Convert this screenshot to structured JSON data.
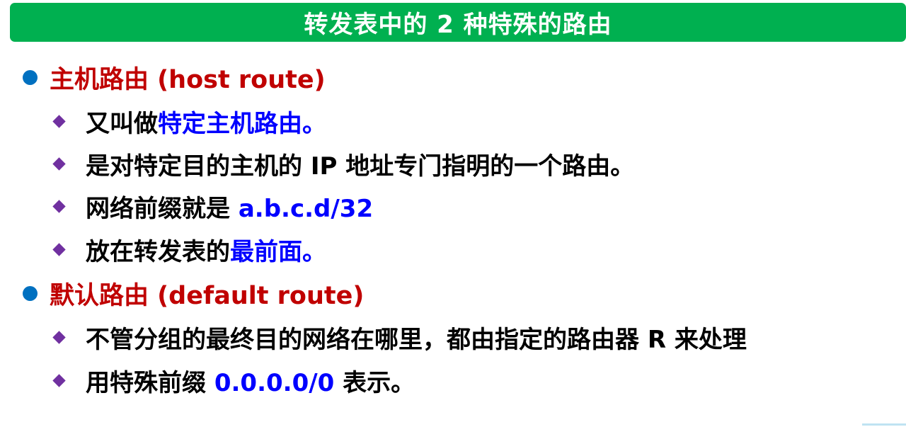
{
  "title": "转发表中的 2 种特殊的路由",
  "sections": [
    {
      "heading": "主机路由 (host route)",
      "items": [
        {
          "pre": "又叫做",
          "hl": "特定主机路由。",
          "post": ""
        },
        {
          "pre": "是对特定目的主机的 IP 地址专门指明的一个路由。",
          "hl": "",
          "post": ""
        },
        {
          "pre": "网络前缀就是 ",
          "hl": "a.b.c.d/32",
          "post": ""
        },
        {
          "pre": "放在转发表的",
          "hl": "最前面。",
          "post": ""
        }
      ]
    },
    {
      "heading": "默认路由 (default route)",
      "items": [
        {
          "pre": "不管分组的最终目的网络在哪里，都由指定的路由器 R 来处理",
          "hl": "",
          "post": ""
        },
        {
          "pre": "用特殊前缀 ",
          "hl": "0.0.0.0/0",
          "post": " 表示。"
        }
      ]
    }
  ],
  "colors": {
    "title_bar": "#00b050",
    "title_text": "#ffffff",
    "section_bullet": "#0070c0",
    "section_heading": "#c00000",
    "item_bullet": "#7030a0",
    "item_text": "#000000",
    "highlight": "#0000ff"
  },
  "icons": {
    "section_bullet": "blue-dot-bullet-icon",
    "item_bullet": "purple-diamond-bullet-icon"
  }
}
